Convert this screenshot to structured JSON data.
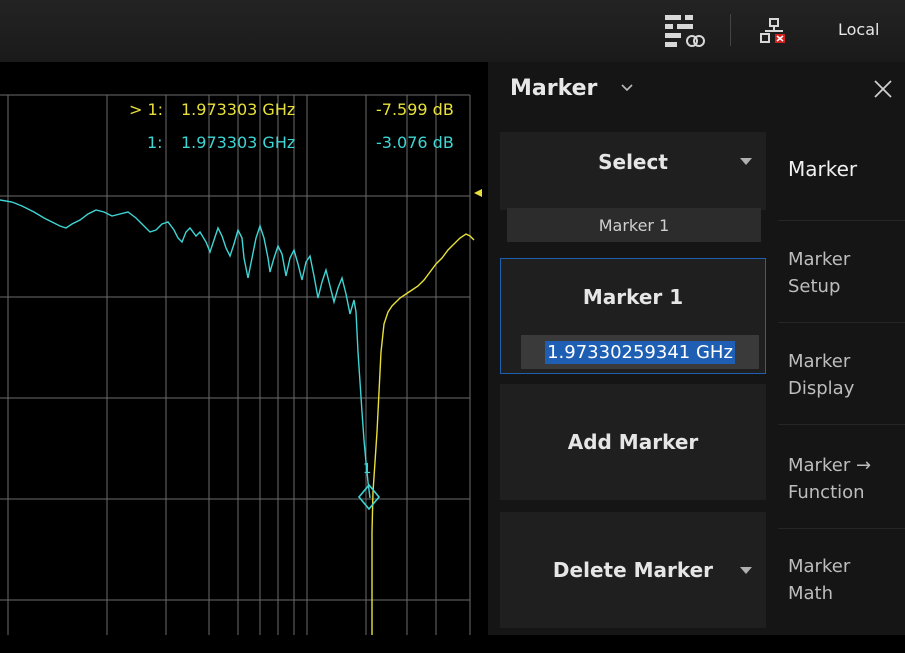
{
  "topbar": {
    "local_label": "Local",
    "icons": [
      "display-layout-icon",
      "network-disconnected-icon"
    ]
  },
  "trace": {
    "readouts": [
      {
        "prefix": "> 1:",
        "freq": "1.973303 GHz",
        "value": "-7.599 dB",
        "color": "#e8e03a"
      },
      {
        "prefix": "1:",
        "freq": "1.973303 GHz",
        "value": "-3.076 dB",
        "color": "#3fd5d5"
      }
    ],
    "marker_label": "1",
    "reference_arrow_color": "#e8e03a",
    "trace_colors": {
      "cyan": "#3fd5d5",
      "yellow": "#e8e03a"
    }
  },
  "panel": {
    "title": "Marker",
    "select_label": "Select",
    "select_value": "Marker 1",
    "marker_title": "Marker 1",
    "marker_freq": "1.97330259341 GHz",
    "add_label": "Add Marker",
    "delete_label": "Delete Marker",
    "softkeys": {
      "marker": "Marker",
      "setup_1": "Marker",
      "setup_2": "Setup",
      "display_1": "Marker",
      "display_2": "Display",
      "function_1": "Marker →",
      "function_2": "Function",
      "math_1": "Marker",
      "math_2": "Math"
    }
  },
  "colors": {
    "accent": "#1e5fb4",
    "panel_bg": "#151515",
    "button_bg": "#1f1f1f"
  }
}
